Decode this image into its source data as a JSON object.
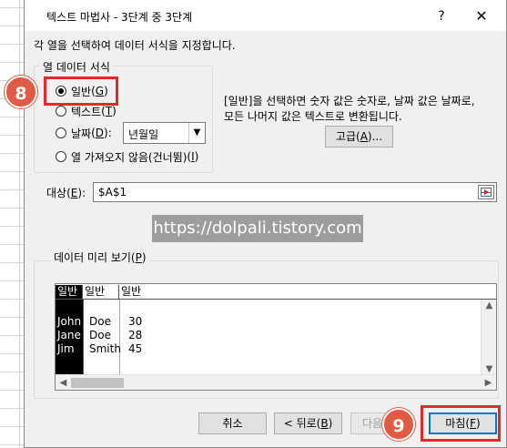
{
  "window": {
    "title": "텍스트 마법사 - 3단계 중 3단계",
    "help_glyph": "?",
    "close_glyph": "✕"
  },
  "instruction": "각 열을 선택하여 데이터 서식을 지정합니다.",
  "column_format": {
    "group_label": "열 데이터 서식",
    "options": [
      {
        "label": "일반",
        "key": "G",
        "selected": true
      },
      {
        "label": "텍스트",
        "key": "T",
        "selected": false
      },
      {
        "label": "날짜",
        "key": "D",
        "suffix": ":",
        "selected": false
      },
      {
        "label": "열 가져오지 않음(건너뜀)",
        "key": "I",
        "selected": false
      }
    ],
    "date_format_value": "년월일"
  },
  "description": {
    "line1": "[일반]을 선택하면 숫자 값은 숫자로, 날짜 값은 날짜로,",
    "line2": "모든 나머지 값은 텍스트로 변환됩니다."
  },
  "advanced_button": {
    "label": "고급",
    "key": "A",
    "suffix": "..."
  },
  "destination": {
    "label": "대상",
    "key": "E",
    "suffix": ":",
    "value": "$A$1"
  },
  "watermark": "https://dolpali.tistory.com",
  "preview": {
    "group_label": "데이터 미리 보기",
    "key": "P",
    "headers": [
      "일반",
      "일반",
      "일반"
    ],
    "rows": [
      [
        "John",
        "Doe",
        "30"
      ],
      [
        "Jane",
        "Doe",
        "28"
      ],
      [
        "Jim",
        "Smith",
        "45"
      ]
    ]
  },
  "buttons": {
    "cancel": "취소",
    "back": "< 뒤로",
    "back_key": "B",
    "next": "다음",
    "finish": "마침",
    "finish_key": "F"
  },
  "annotations": {
    "step_8": "8",
    "step_9": "9",
    "highlight_color": "#e8272a",
    "badge_color": "#e05a44"
  }
}
